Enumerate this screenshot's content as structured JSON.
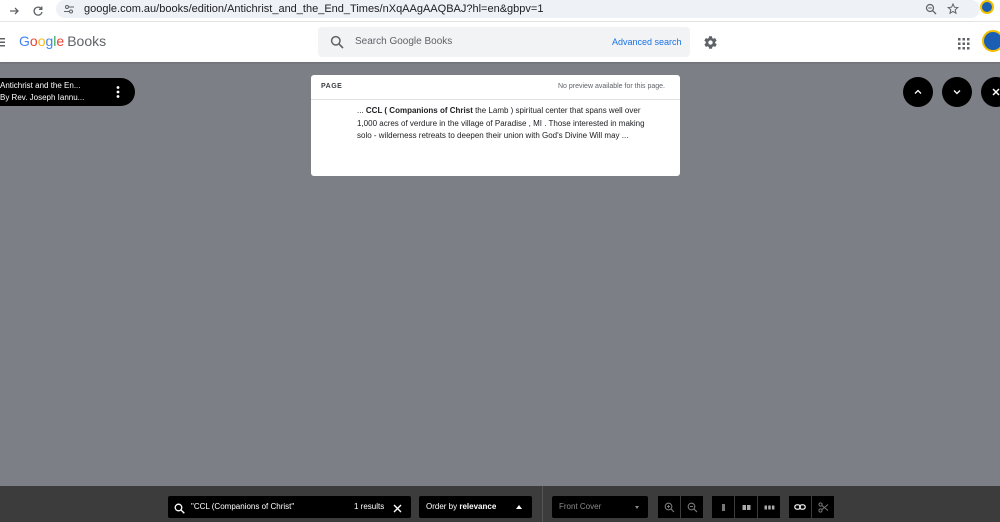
{
  "browser": {
    "url": "google.com.au/books/edition/Antichrist_and_the_End_Times/nXqAAgAAQBAJ?hl=en&gbpv=1"
  },
  "header": {
    "logo_google": "Google",
    "logo_books": "Books",
    "search_placeholder": "Search Google Books",
    "advanced_search": "Advanced search"
  },
  "book": {
    "title": "Antichrist and the En...",
    "author": "By Rev. Joseph Iannu..."
  },
  "page_card": {
    "label": "PAGE",
    "notice": "No preview available for this page.",
    "snippet_prefix": "... ",
    "snippet_bold": "CCL ( Companions of Christ",
    "snippet_rest": " the Lamb ) spiritual center that spans well over 1,000 acres of verdure in the village of Paradise , MI . Those interested in making solo - wilderness retreats to deepen their union with God's Divine Will may ..."
  },
  "bottom_bar": {
    "search_query": "\"CCL (Companions of Christ\"",
    "results_count": "1 results",
    "order_prefix": "Order by ",
    "order_value": "relevance",
    "front_cover": "Front Cover"
  },
  "colors": {
    "page_background": "#7d7f86",
    "toolbar_background": "#3c3c3c",
    "link_blue": "#1a73e8"
  }
}
